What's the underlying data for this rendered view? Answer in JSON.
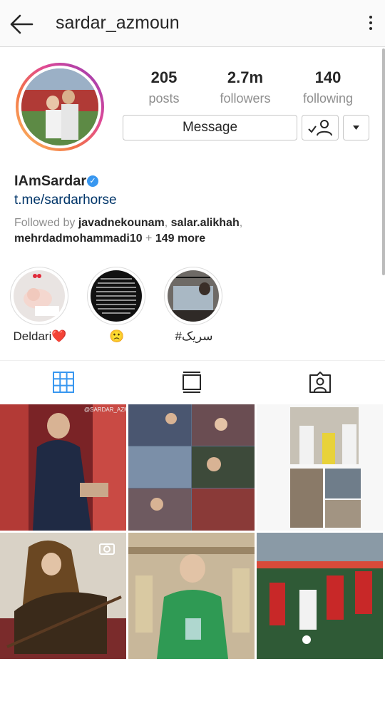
{
  "header": {
    "username": "sardar_azmoun"
  },
  "stats": [
    {
      "value": "205",
      "label": "posts"
    },
    {
      "value": "2.7m",
      "label": "followers"
    },
    {
      "value": "140",
      "label": "following"
    }
  ],
  "actions": {
    "message_label": "Message"
  },
  "bio": {
    "name": "IAmSardar",
    "link": "t.me/sardarhorse",
    "followed_prefix": "Followed by",
    "followed_users": [
      "javadnekounam",
      "salar.alikhah",
      "mehrdadmohammadi10"
    ],
    "followed_sep": ", ",
    "followed_plus": " + ",
    "followed_more": "149 more"
  },
  "highlights": [
    {
      "label": "Deldari❤️"
    },
    {
      "label": "🙁"
    },
    {
      "label": "#سریک"
    }
  ],
  "tabs": [
    {
      "icon": "grid-icon",
      "active": true
    },
    {
      "icon": "igtv-icon",
      "active": false
    },
    {
      "icon": "tagged-icon",
      "active": false
    }
  ],
  "colors": {
    "accent": "#3897f0",
    "link": "#003569",
    "muted": "#8e8e8e"
  }
}
